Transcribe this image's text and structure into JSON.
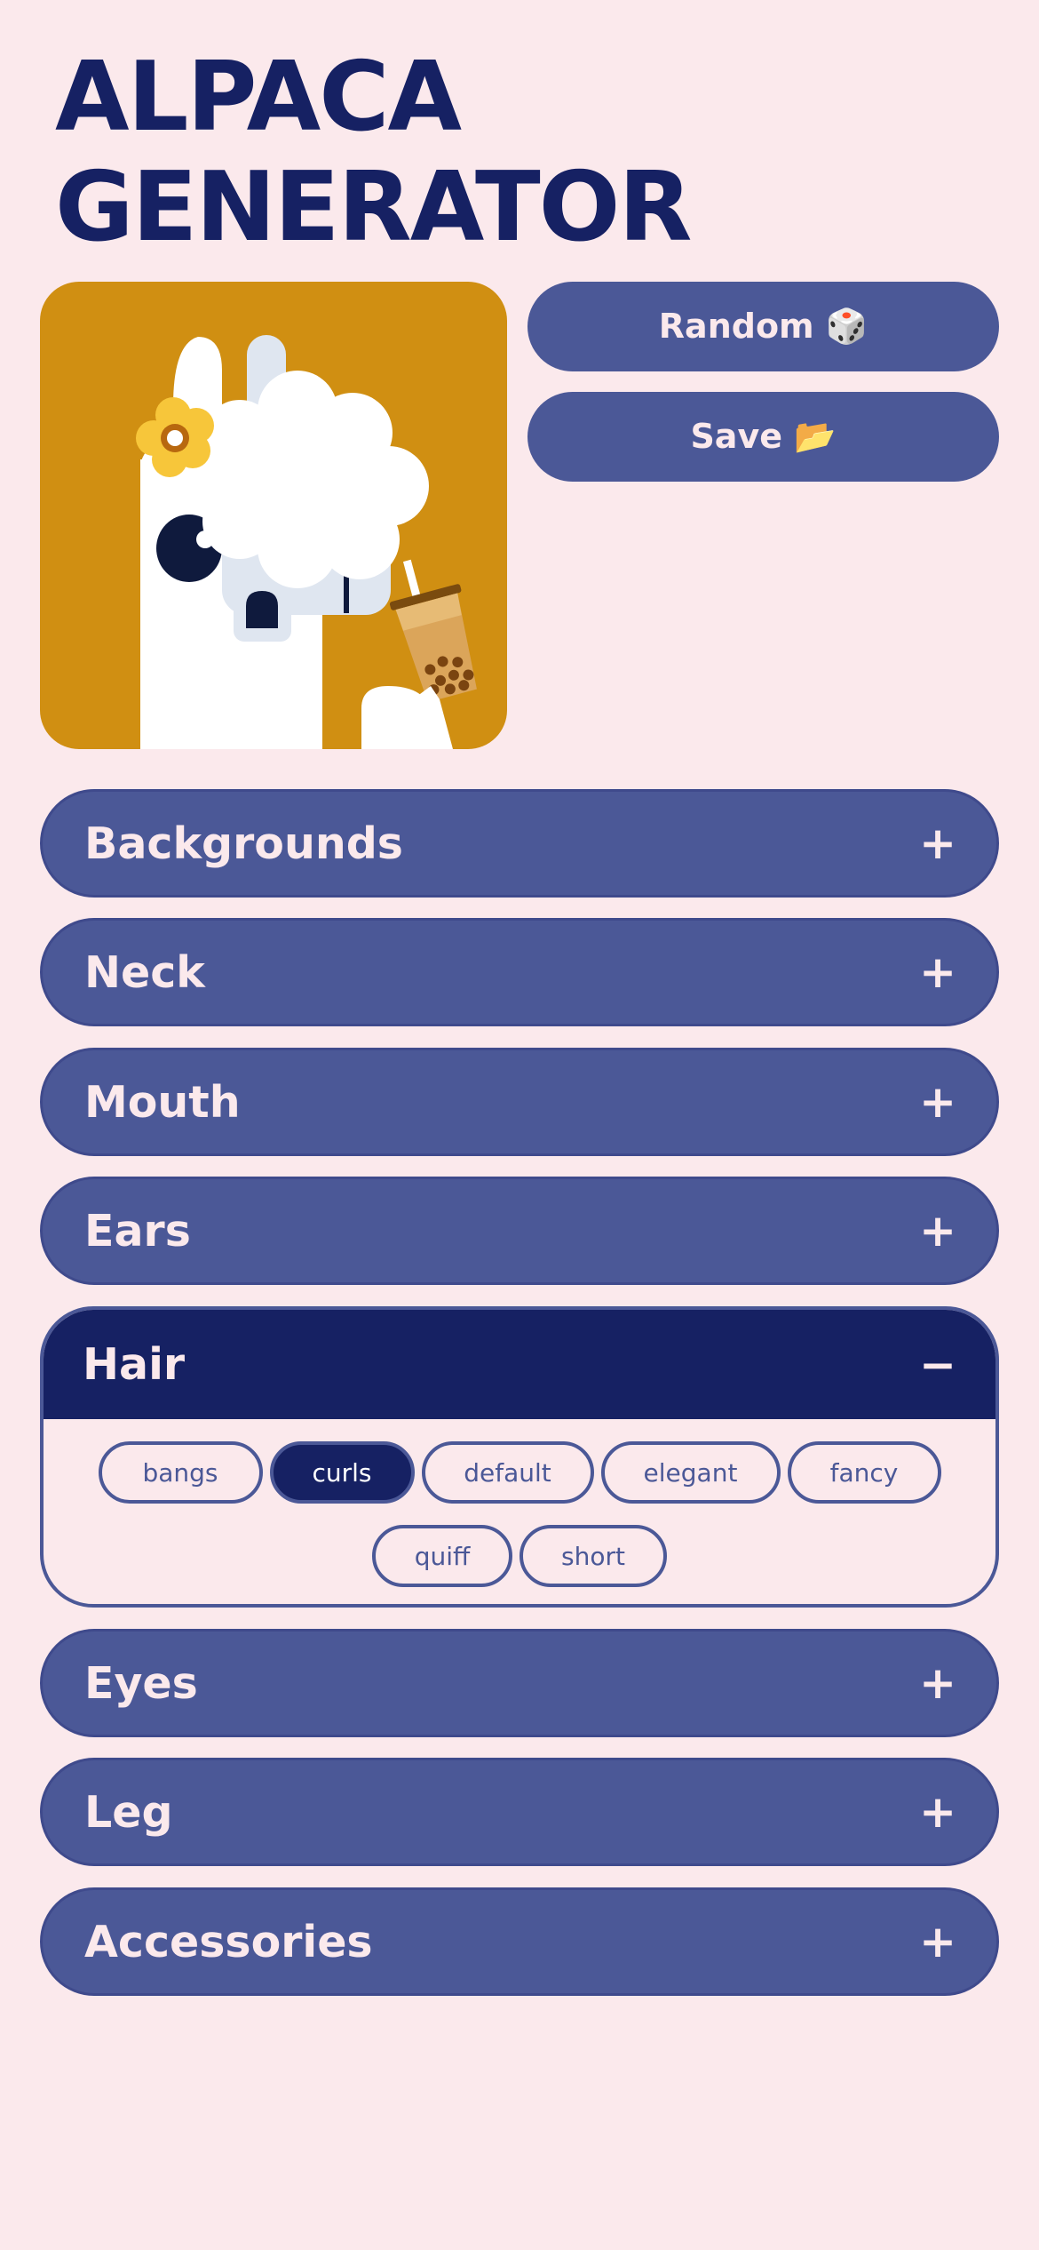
{
  "app": {
    "title": "ALPACA\nGENERATOR"
  },
  "actions": {
    "random_label": "Random 🎲",
    "save_label": "Save 📂"
  },
  "colors": {
    "background": "#fbe9ec",
    "accent": "#4b5897",
    "dark": "#162163",
    "preview_bg": "#d08f12"
  },
  "accordions": [
    {
      "label": "Backgrounds",
      "sign": "+"
    },
    {
      "label": "Neck",
      "sign": "+"
    },
    {
      "label": "Mouth",
      "sign": "+"
    },
    {
      "label": "Ears",
      "sign": "+"
    },
    {
      "label": "Hair",
      "sign": "−",
      "open": true,
      "options": [
        "bangs",
        "curls",
        "default",
        "elegant",
        "fancy",
        "quiff",
        "short"
      ],
      "selected": "curls"
    },
    {
      "label": "Eyes",
      "sign": "+"
    },
    {
      "label": "Leg",
      "sign": "+"
    },
    {
      "label": "Accessories",
      "sign": "+"
    }
  ]
}
